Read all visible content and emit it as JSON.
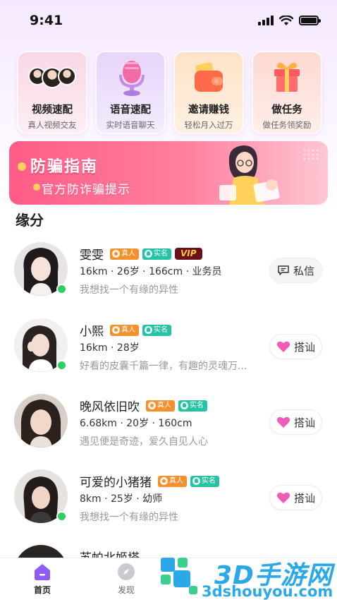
{
  "status_bar": {
    "time": "9:41"
  },
  "quick_entries": [
    {
      "title": "视频速配",
      "subtitle": "真人视频交友",
      "icon": "video-avatars-icon"
    },
    {
      "title": "语音速配",
      "subtitle": "实时语音聊天",
      "icon": "microphone-icon"
    },
    {
      "title": "邀请赚钱",
      "subtitle": "轻松月入过万",
      "icon": "wallet-icon"
    },
    {
      "title": "做任务",
      "subtitle": "做任务领奖励",
      "icon": "gift-box-icon"
    }
  ],
  "banner": {
    "title": "防骗指南",
    "subtitle": "官方防诈骗提示"
  },
  "section_title": "缘分",
  "users": [
    {
      "name": "雯雯",
      "badges": [
        "真人",
        "实名",
        "VIP"
      ],
      "stats": "16km · 26岁 · 166cm · 业务员",
      "bio": "我想找一个有缘的异性",
      "online": true,
      "action": "私信",
      "action_icon": "message-icon"
    },
    {
      "name": "小熙",
      "badges": [
        "真人",
        "实名"
      ],
      "stats": "16km · 28岁",
      "bio": "好看的皮囊千篇一律，有趣的灵魂万...",
      "online": true,
      "action": "搭讪",
      "action_icon": "heart-icon"
    },
    {
      "name": "晚风依旧吹",
      "badges": [
        "真人",
        "实名"
      ],
      "stats": "6.68km · 20岁 · 160cm",
      "bio": "遇见便是奇迹，爱久自见人心",
      "online": false,
      "action": "搭讪",
      "action_icon": "heart-icon"
    },
    {
      "name": "可爱的小猪猪",
      "badges": [
        "真人",
        "实名"
      ],
      "stats": "8km · 25岁 · 幼师",
      "bio": "我想找一个有缘的异性",
      "online": true,
      "action": "搭讪",
      "action_icon": "heart-icon"
    },
    {
      "name": "苏帕北姬塔",
      "badges": [],
      "stats": "",
      "bio": "",
      "online": false,
      "action": "",
      "action_icon": ""
    }
  ],
  "bottom_nav": [
    {
      "label": "首页",
      "icon": "home-icon",
      "active": true
    },
    {
      "label": "发现",
      "icon": "compass-icon",
      "active": false
    }
  ],
  "watermark": {
    "text": "3D手游网",
    "url": "3dshouyou.com"
  },
  "colors": {
    "accent_pink": "#ff5c87",
    "online_green": "#2fd060",
    "badge_real": "#f5912d",
    "badge_verified": "#27c2a4",
    "vip_bg": "#6a1018"
  }
}
